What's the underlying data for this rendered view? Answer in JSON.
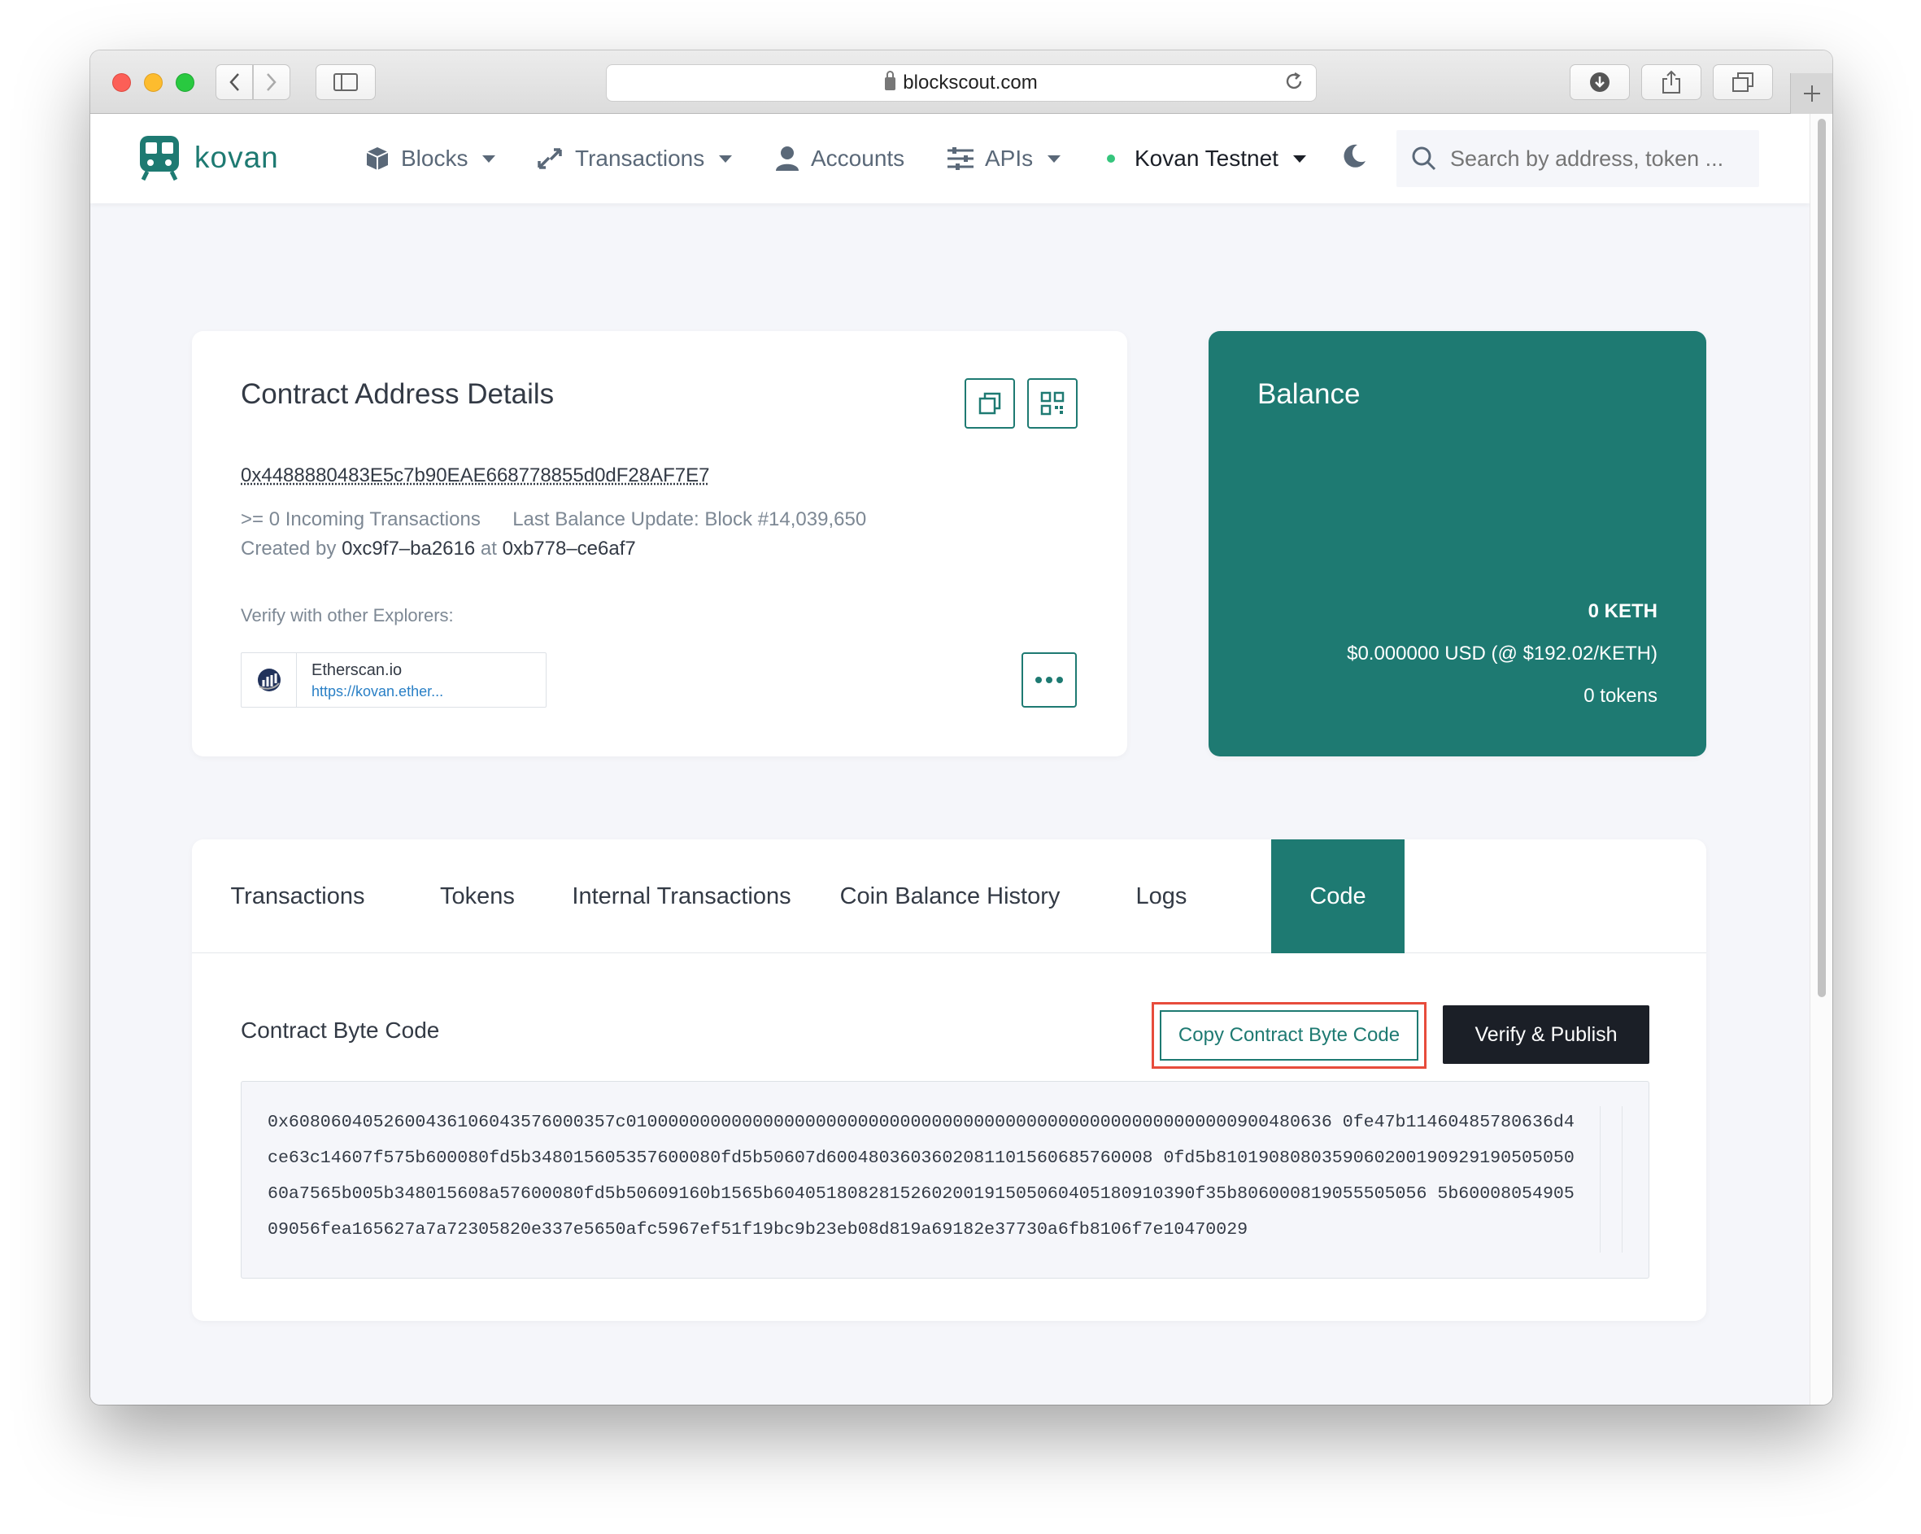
{
  "browser": {
    "url": "blockscout.com",
    "back_icon": "‹",
    "forward_icon": "›"
  },
  "nav": {
    "logo_text": "kovan",
    "blocks": "Blocks",
    "transactions": "Transactions",
    "accounts": "Accounts",
    "apis": "APIs",
    "network": "Kovan Testnet",
    "search_placeholder": "Search by address, token ..."
  },
  "details": {
    "title": "Contract Address Details",
    "address": "0x4488880483E5c7b90EAE668778855d0dF28AF7E7",
    "incoming": ">= 0 Incoming Transactions",
    "last_balance": "Last Balance Update: Block #14,039,650",
    "created_by_label": "Created by",
    "creator": "0xc9f7–ba2616",
    "at_label": "at",
    "tx": "0xb778–ce6af7",
    "verify_label": "Verify with other Explorers:",
    "explorer_name": "Etherscan.io",
    "explorer_link": "https://kovan.ether..."
  },
  "balance": {
    "title": "Balance",
    "keth": "0 KETH",
    "usd": "$0.000000 USD (@ $192.02/KETH)",
    "tokens": "0 tokens"
  },
  "tabs": [
    {
      "label": "Transactions"
    },
    {
      "label": "Tokens"
    },
    {
      "label": "Internal Transactions"
    },
    {
      "label": "Coin Balance History"
    },
    {
      "label": "Logs"
    },
    {
      "label": "Code"
    }
  ],
  "code": {
    "title": "Contract Byte Code",
    "copy_label": "Copy Contract Byte Code",
    "publish_label": "Verify & Publish",
    "lines": [
      "0x6080604052600436106043576000357c0100000000000000000000000000000000000000000000000000000000900480636 0fe47b11460485780636d4",
      "ce63c14607f575b600080fd5b348015605357600080fd5b50607d6004803603602081101560685760008 0fd5b8101908080359060200190929190505050",
      "60a7565b005b348015608a57600080fd5b50609160b1565b6040518082815260200191505060405180910390f35b806000819055505056 5b60008054905",
      "09056fea165627a7a72305820e337e5650afc5967ef51f19bc9b23eb08d819a69182e37730a6fb8106f7e10470029"
    ]
  },
  "colors": {
    "brand": "#1e7a72",
    "footer": "#1b1f27",
    "highlight": "#e74c3c"
  }
}
